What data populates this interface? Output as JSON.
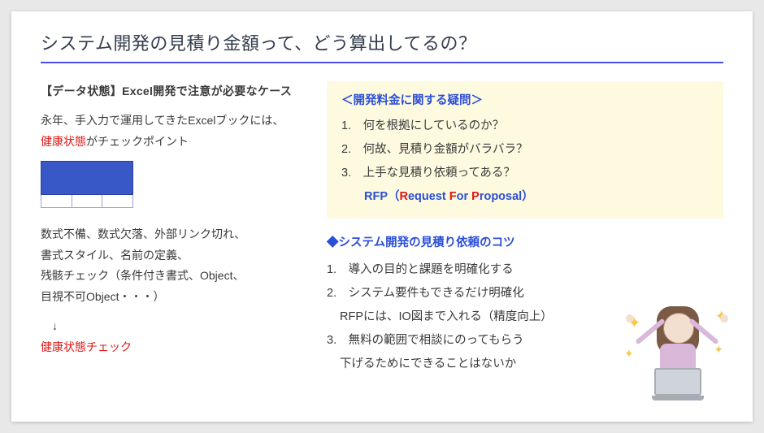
{
  "title": "システム開発の見積り金額って、どう算出してるの？",
  "left": {
    "heading": "【データ状態】Excel開発で注意が必要なケース",
    "line1_prefix": "永年、手入力で運用してきたExcelブックには、",
    "health_word": "健康状態",
    "line1_suffix": "がチェックポイント",
    "block2_l1": "数式不備、数式欠落、外部リンク切れ、",
    "block2_l2": "書式スタイル、名前の定義、",
    "block2_l3": "残骸チェック（条件付き書式、Object、",
    "block2_l4": "目視不可Object・・・）",
    "arrow": "↓",
    "health_check": "健康状態チェック"
  },
  "questions": {
    "heading": "＜開発料金に関する疑問＞",
    "items": [
      "何を根拠にしているのか？",
      "何故、見積り金額がバラバラ？",
      "上手な見積り依頼ってある？"
    ],
    "rfp_label": "RFP（",
    "rfp_r": "R",
    "rfp_equest": "equest ",
    "rfp_f": "F",
    "rfp_or": "or ",
    "rfp_p": "P",
    "rfp_roposal": "roposal）"
  },
  "tips": {
    "heading_diamond": "◆",
    "heading": "システム開発の見積り依頼のコツ",
    "items": [
      {
        "main": "導入の目的と課題を明確化する"
      },
      {
        "main": "システム要件もできるだけ明確化",
        "sub": "RFPには、IO図まで入れる（精度向上）"
      },
      {
        "main": "無料の範囲で相談にのってもらう",
        "sub": "下げるためにできることはないか"
      }
    ]
  }
}
